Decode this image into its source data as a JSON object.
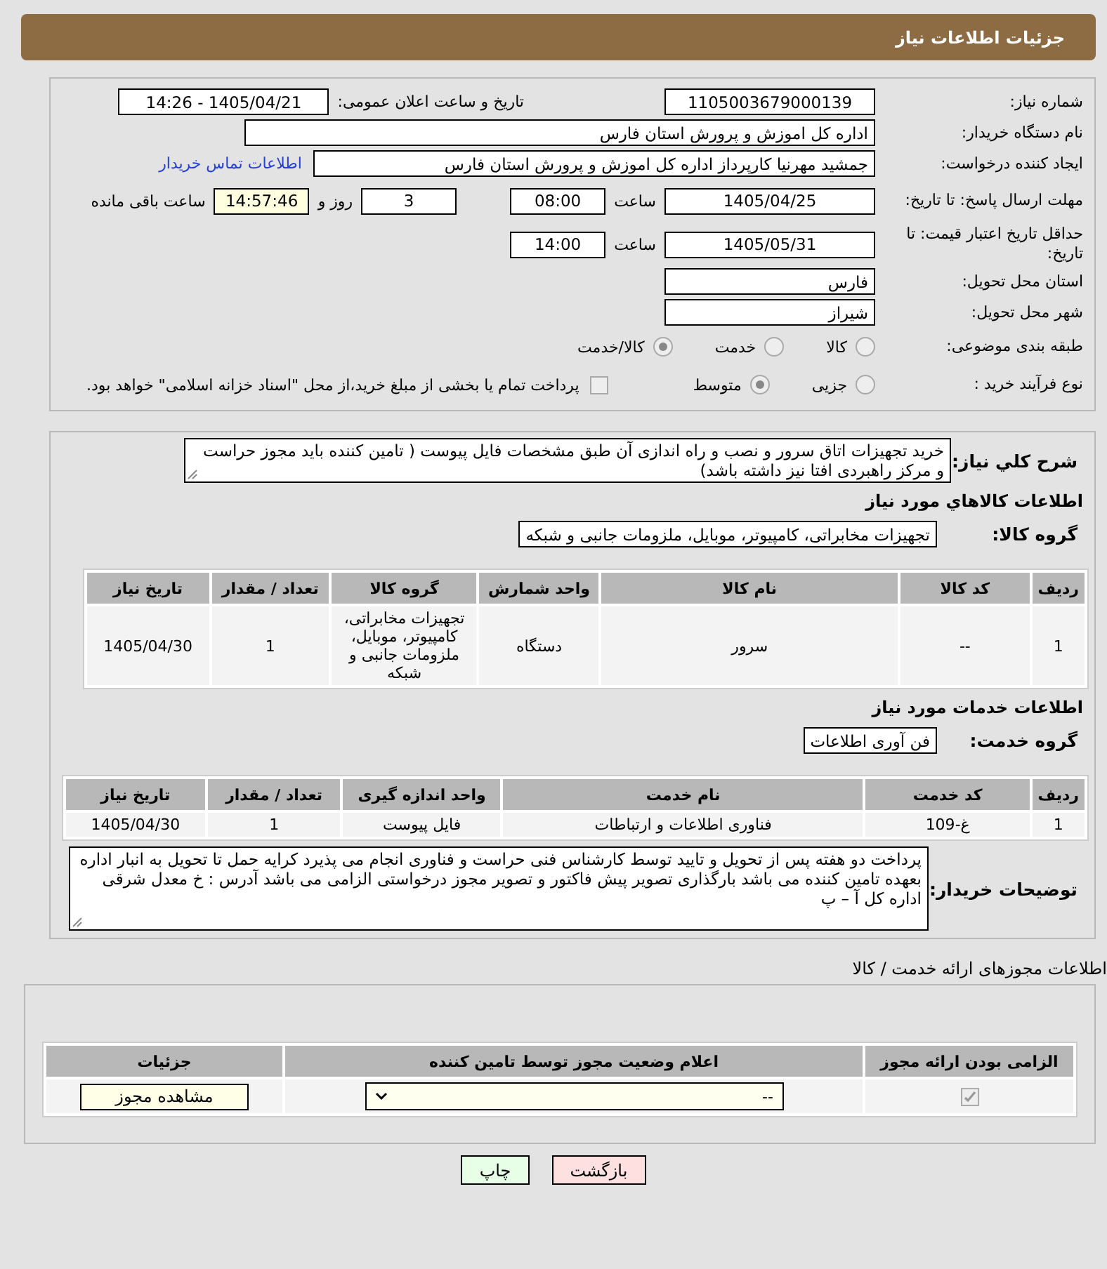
{
  "page_title": "جزئیات اطلاعات نیاز",
  "form": {
    "need_number": {
      "label": "شماره نیاز:",
      "value": "1105003679000139"
    },
    "announce": {
      "label": "تاریخ و ساعت اعلان عمومی:",
      "value": "1405/04/21 - 14:26"
    },
    "buyer": {
      "label": "نام دستگاه خریدار:",
      "value": "اداره کل اموزش و پرورش استان فارس"
    },
    "requester": {
      "label": "ایجاد کننده درخواست:",
      "value": "جمشید مهرنیا کارپرداز اداره کل اموزش و پرورش استان فارس",
      "link": "اطلاعات تماس خریدار"
    },
    "deadline": {
      "label": "مهلت ارسال پاسخ: تا تاریخ:",
      "date": "1405/04/25",
      "time_label": "ساعت",
      "time": "08:00",
      "days": "3",
      "days_label": "روز و",
      "remaining": "14:57:46",
      "remaining_label": "ساعت باقی مانده"
    },
    "validity": {
      "label": "حداقل تاریخ اعتبار قیمت: تا تاریخ:",
      "date": "1405/05/31",
      "time_label": "ساعت",
      "time": "14:00"
    },
    "province": {
      "label": "استان محل تحویل:",
      "value": "فارس"
    },
    "city": {
      "label": "شهر محل تحویل:",
      "value": "شیراز"
    },
    "category": {
      "label": "طبقه بندی موضوعی:",
      "options": [
        {
          "label": "کالا",
          "selected": false
        },
        {
          "label": "خدمت",
          "selected": false
        },
        {
          "label": "کالا/خدمت",
          "selected": true
        }
      ]
    },
    "process": {
      "label": "نوع فرآیند خرید :",
      "options": [
        {
          "label": "جزیی",
          "selected": false
        },
        {
          "label": "متوسط",
          "selected": true
        }
      ],
      "payment": {
        "label": "پرداخت تمام یا بخشی از مبلغ خرید،از محل \"اسناد خزانه اسلامی\" خواهد بود.",
        "checked": false
      }
    }
  },
  "description": {
    "label": "شرح کلي نياز:",
    "value": "خرید تجهیزات اتاق سرور  و نصب و راه اندازی آن طبق مشخصات فایل پیوست (  تامین کننده باید مجوز حراست و مرکز راهبردی افتا نیز داشته باشد)"
  },
  "goods": {
    "heading": "اطلاعات كالاهاي مورد نياز",
    "group_label": "گروه کالا:",
    "group": "تجهیزات مخابراتی، کامپیوتر، موبایل، ملزومات جانبی و شبکه",
    "columns": [
      "ردیف",
      "کد کالا",
      "نام کالا",
      "واحد شمارش",
      "گروه کالا",
      "تعداد / مقدار",
      "تاریخ نیاز"
    ],
    "rows": [
      [
        "1",
        "--",
        "سرور",
        "دستگاه",
        "تجهیزات مخابراتی، کامپیوتر، موبایل، ملزومات جانبی و شبکه",
        "1",
        "1405/04/30"
      ]
    ]
  },
  "services": {
    "heading": "اطلاعات خدمات مورد نیاز",
    "group_label": "گروه خدمت:",
    "group": "فن آوری اطلاعات",
    "columns": [
      "ردیف",
      "کد خدمت",
      "نام خدمت",
      "واحد اندازه گیری",
      "تعداد / مقدار",
      "تاریخ نیاز"
    ],
    "rows": [
      [
        "1",
        "غ-109",
        "فناوری اطلاعات و ارتباطات",
        "فایل پیوست",
        "1",
        "1405/04/30"
      ]
    ]
  },
  "buyer_notes": {
    "label": "توضیحات خریدار:",
    "value": "پرداخت دو هفته پس از تحویل و تایید توسط کارشناس فنی حراست و فناوری انجام می پذیرد کرایه حمل تا تحویل به انبار اداره بعهده تامین کننده می باشد بارگذاری تصویر پیش فاکتور و تصویر مجوز درخواستی الزامی می باشد آدرس : خ معدل شرقی اداره کل آ – پ"
  },
  "permits": {
    "heading": "اطلاعات مجوزهای ارائه خدمت / کالا",
    "columns": [
      "الزامی بودن ارائه مجوز",
      "اعلام وضعیت مجوز توسط تامین کننده",
      "جزئیات"
    ],
    "rows": [
      {
        "required": true,
        "status": "--",
        "action": "مشاهده مجوز"
      }
    ]
  },
  "buttons": [
    {
      "label": "بازگشت",
      "kind": "back"
    },
    {
      "label": "چاپ",
      "kind": "print"
    }
  ]
}
